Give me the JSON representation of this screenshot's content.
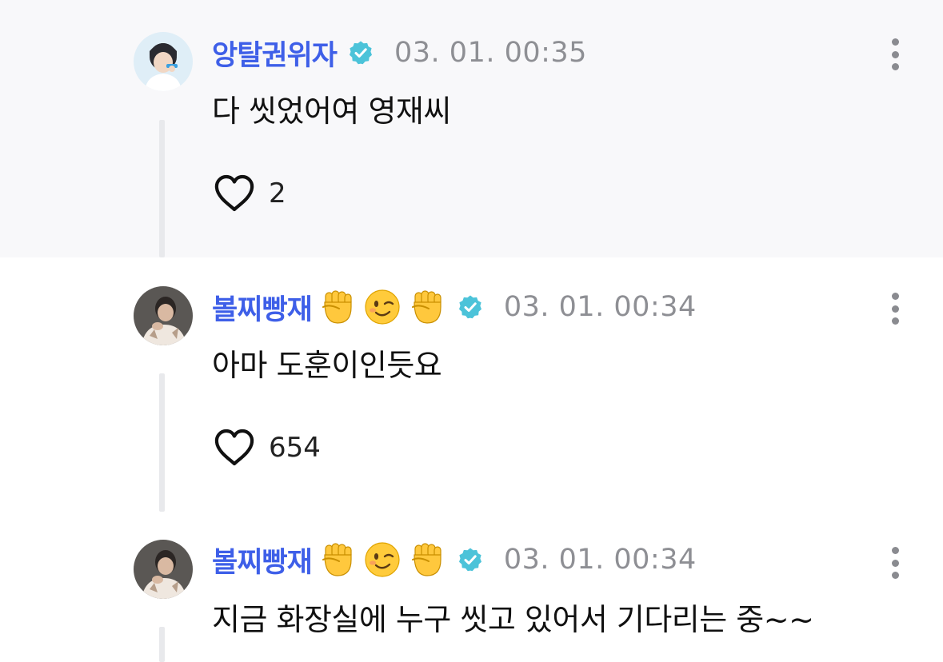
{
  "comments": [
    {
      "username": "앙탈권위자",
      "emojis": [],
      "timestamp": "03. 01. 00:35",
      "text": "다 씻었어여 영재씨",
      "like_count": "2",
      "highlighted": true
    },
    {
      "username": "볼찌빵재",
      "emojis": [
        "raised-fist-emoji",
        "winking-face-emoji",
        "raised-fist-emoji"
      ],
      "timestamp": "03. 01. 00:34",
      "text": "아마 도훈이인듯요",
      "like_count": "654",
      "highlighted": false
    },
    {
      "username": "볼찌빵재",
      "emojis": [
        "raised-fist-emoji",
        "winking-face-emoji",
        "raised-fist-emoji"
      ],
      "timestamp": "03. 01. 00:34",
      "text": "지금 화장실에 누구 씻고 있어서 기다리는 중~~",
      "highlighted": false
    }
  ],
  "colors": {
    "username": "#3e5fe8",
    "verified_badge": "#4cc3d9",
    "timestamp": "#8e8f94",
    "highlight_bg": "#f8f8fa"
  },
  "icons": {
    "verified": "verified-badge-icon",
    "like": "heart-icon",
    "more": "more-vertical-icon"
  }
}
